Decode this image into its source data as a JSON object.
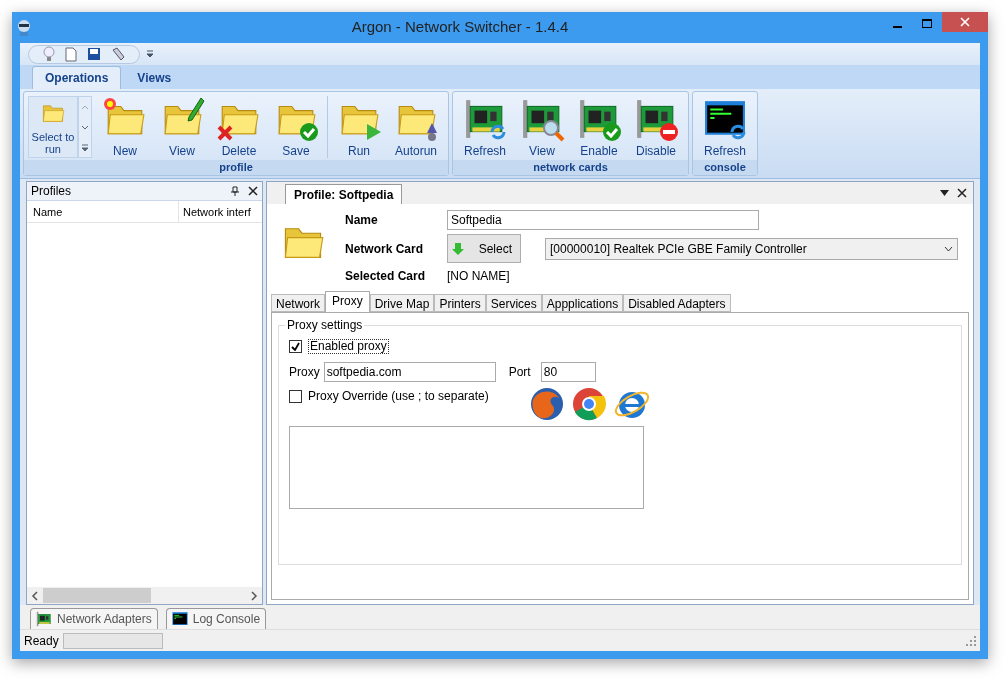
{
  "window": {
    "title": "Argon - Network Switcher - 1.4.4"
  },
  "ribbon_tabs": [
    {
      "label": "Operations",
      "selected": true
    },
    {
      "label": "Views",
      "selected": false
    }
  ],
  "ribbon_groups": [
    {
      "label": "profile",
      "select_to_run": "Select to run",
      "buttons": [
        {
          "label": "New",
          "kind": "folder"
        },
        {
          "label": "View",
          "kind": "folder"
        },
        {
          "label": "Delete",
          "kind": "folder"
        },
        {
          "label": "Save",
          "kind": "folder"
        },
        {
          "label": "Run",
          "kind": "folder"
        },
        {
          "label": "Autorun",
          "kind": "folder"
        }
      ]
    },
    {
      "label": "network cards",
      "buttons": [
        {
          "label": "Refresh",
          "kind": "card"
        },
        {
          "label": "View",
          "kind": "card"
        },
        {
          "label": "Enable",
          "kind": "card"
        },
        {
          "label": "Disable",
          "kind": "card"
        }
      ]
    },
    {
      "label": "console",
      "buttons": [
        {
          "label": "Refresh",
          "kind": "console"
        }
      ]
    }
  ],
  "profiles_pane": {
    "title": "Profiles",
    "columns": [
      "Name",
      "Network interf"
    ]
  },
  "document": {
    "tab": "Profile: Softpedia",
    "name_label": "Name",
    "name_value": "Softpedia",
    "card_label": "Network Card",
    "select_button": "Select",
    "card_value": "[00000010] Realtek PCIe GBE Family Controller",
    "selected_label": "Selected Card",
    "selected_value": "[NO NAME]",
    "tabs": [
      {
        "label": "Network",
        "selected": false
      },
      {
        "label": "Proxy",
        "selected": true
      },
      {
        "label": "Drive Map",
        "selected": false
      },
      {
        "label": "Printers",
        "selected": false
      },
      {
        "label": "Services",
        "selected": false
      },
      {
        "label": "Appplications",
        "selected": false
      },
      {
        "label": "Disabled Adapters",
        "selected": false
      }
    ],
    "group_title": "Proxy settings",
    "enabled_proxy": {
      "label": "Enabled proxy",
      "checked": true
    },
    "proxy_label": "Proxy",
    "proxy_value": "softpedia.com",
    "port_label": "Port",
    "port_value": "80",
    "override": {
      "label": "Proxy Override (use ; to separate)",
      "checked": false
    }
  },
  "bottom_tabs": [
    {
      "label": "Network Adapters",
      "kind": "card"
    },
    {
      "label": "Log Console",
      "kind": "console"
    }
  ],
  "status_bar": {
    "text": "Ready"
  }
}
